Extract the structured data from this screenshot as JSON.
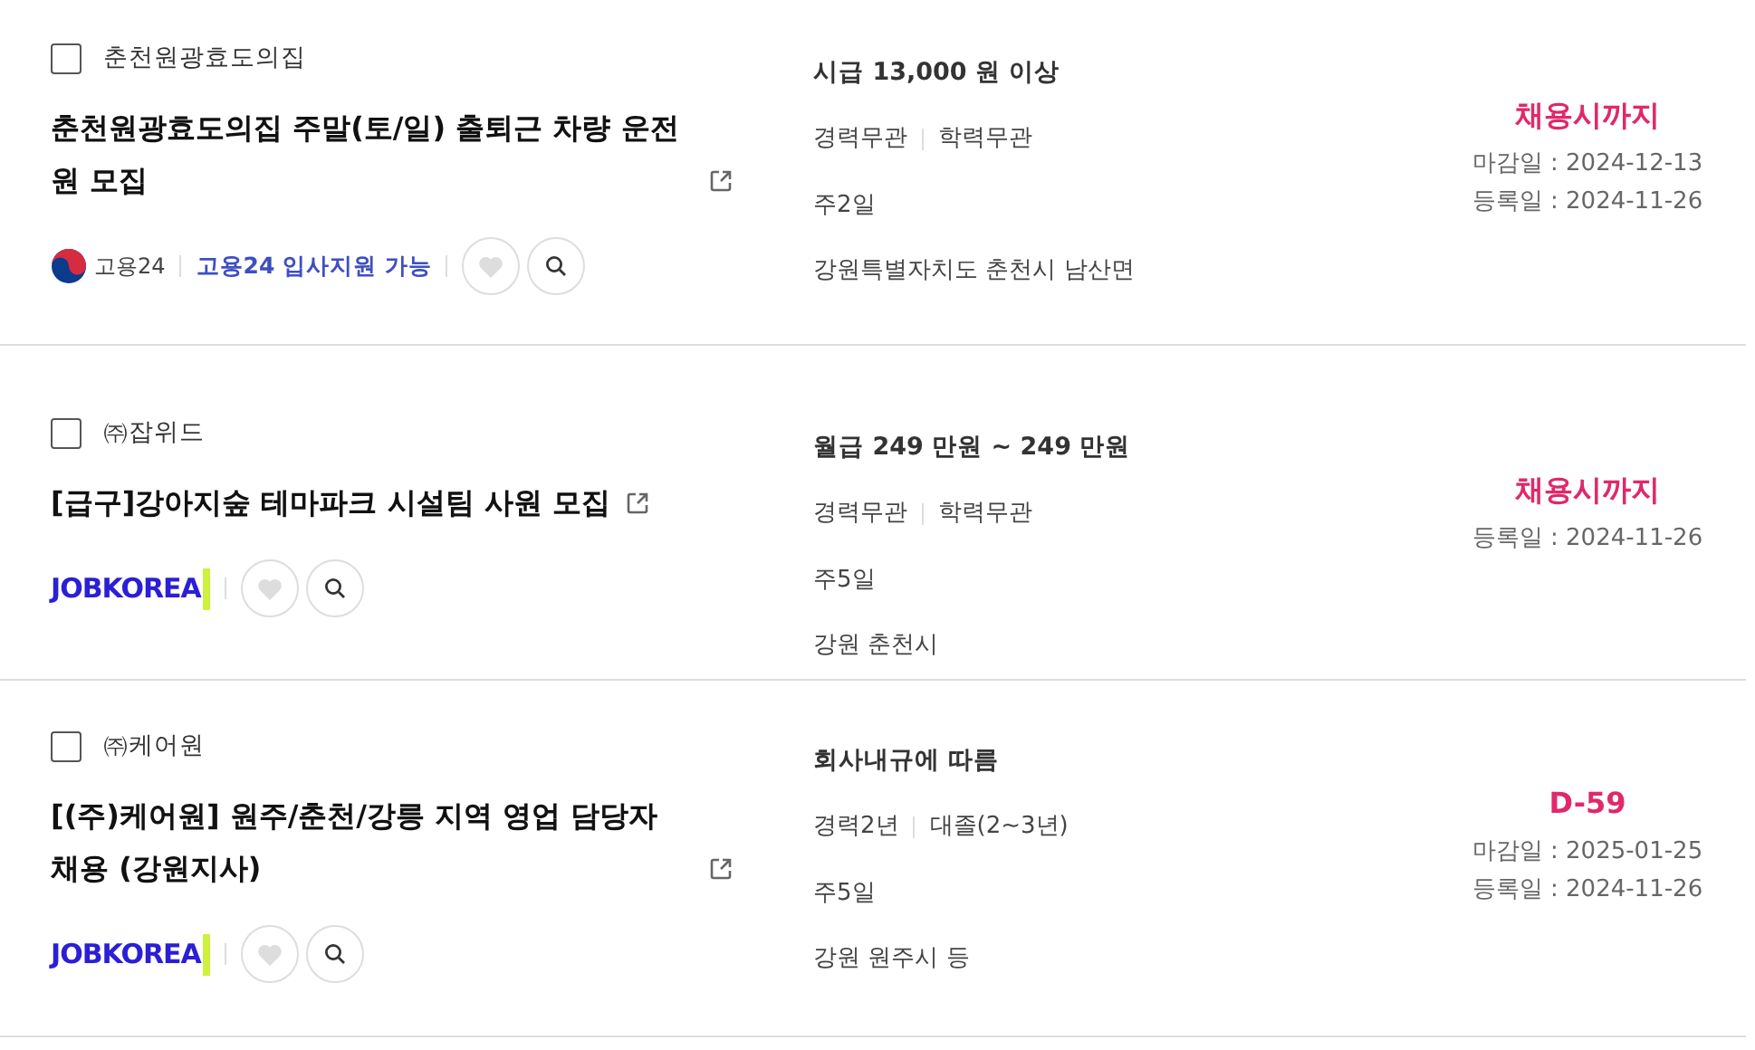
{
  "listings": [
    {
      "company": "춘천원광효도의집",
      "checked": false,
      "title": "춘천원광효도의집 주말(토/일) 출퇴근 차량 운전원 모집",
      "source": {
        "kind": "gov24",
        "name": "고용24",
        "apply": "고용24 입사지원 가능"
      },
      "liked": false,
      "salary": "시급 13,000 원 이상",
      "conditions": [
        "경력무관",
        "학력무관"
      ],
      "workdays": "주2일",
      "location": "강원특별자치도 춘천시 남산면",
      "deadline_label": "채용시까지",
      "dates": [
        "마감일 : 2024-12-13",
        "등록일 : 2024-11-26"
      ]
    },
    {
      "company": "㈜잡위드",
      "checked": false,
      "title": "[급구]강아지숲 테마파크 시설팀 사원 모집",
      "source": {
        "kind": "jobkorea",
        "name": "JOBKOREA"
      },
      "liked": false,
      "salary": "월급 249 만원 ~ 249 만원",
      "conditions": [
        "경력무관",
        "학력무관"
      ],
      "workdays": "주5일",
      "location": "강원 춘천시",
      "deadline_label": "채용시까지",
      "dates": [
        "등록일 : 2024-11-26"
      ]
    },
    {
      "company": "㈜케어원",
      "checked": false,
      "title": "[(주)케어원] 원주/춘천/강릉 지역 영업 담당자 채용 (강원지사)",
      "source": {
        "kind": "jobkorea",
        "name": "JOBKOREA"
      },
      "liked": false,
      "salary": "회사내규에 따름",
      "conditions": [
        "경력2년",
        "대졸(2~3년)"
      ],
      "workdays": "주5일",
      "location": "강원 원주시 등",
      "deadline_label": "D-59",
      "dates": [
        "마감일 : 2025-01-25",
        "등록일 : 2024-11-26"
      ]
    }
  ]
}
